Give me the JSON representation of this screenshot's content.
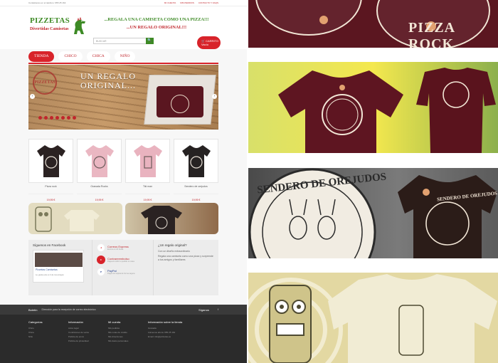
{
  "store": {
    "topbar": {
      "left": "Contáctanos en el teléfono: 955 25 164",
      "right_items": [
        "MI CUENTA",
        "MIS PEDIDOS",
        "CONTACTO Y FAQS"
      ]
    },
    "logo": {
      "line1": "PIZZETAS",
      "line2": "Divertidas Camisetas"
    },
    "slogan": {
      "line1": "...REGALA UNA CAMISETA COMO UNA PIZZA!!!",
      "line2": "...UN REGALO ORIGINAL!!!"
    },
    "cart": {
      "label": "CARRITO",
      "sub": "Vacío"
    },
    "search": {
      "placeholder": "BUSCAR",
      "button": "🔍"
    },
    "nav": [
      "TIENDA",
      "CHICO",
      "CHICA",
      "NIÑO"
    ],
    "slider": {
      "caption1": "UN REGALO",
      "caption2": "ORIGINAL...",
      "stamp": "PIZZETAS",
      "prev": "‹",
      "next": "›"
    },
    "products": [
      {
        "name": "Pizza rock",
        "price": "19,95 €"
      },
      {
        "name": "Granada Rocks",
        "price": "19,95 €"
      },
      {
        "name": "Tiki man",
        "price": "19,95 €"
      },
      {
        "name": "Sendero de orejudos",
        "price": "19,95 €"
      }
    ],
    "widgets": {
      "facebook": {
        "title": "Síguenos en Facebook",
        "caption": "Pizzetas Camisetas",
        "note": "Le gusta esto a 4 de tus amigos"
      },
      "payments": [
        {
          "name": "Correos Express",
          "sub": "Envíos en 24 horas",
          "icon": "truck-icon",
          "color": "#d8232a"
        },
        {
          "name": "Contrareembolso",
          "sub": "Paga al recibir tu pedido en casa",
          "icon": "cash-icon",
          "color": "#d8232a"
        },
        {
          "name": "PayPal",
          "sub": "Paga con tarjeta de forma segura",
          "icon": "paypal-icon",
          "color": "#1f3b8a"
        }
      ],
      "gift": {
        "title": "¿Un regalo original?",
        "sub": "Con un diseño extraordinario",
        "body": "Regala una camiseta como una pizza y sorprende a tus amigos y familiares"
      }
    },
    "footer": {
      "newsletter_label": "Boletín",
      "newsletter_text": "Dirección para la recepción de correo electrónico",
      "follow_label": "Síganos",
      "follow_icon": "facebook-icon",
      "columns": [
        {
          "title": "Categorías",
          "items": [
            "Chico",
            "Chica",
            "Niño"
          ]
        },
        {
          "title": "Información",
          "items": [
            "Aviso legal",
            "Condiciones de venta",
            "Política de envío",
            "Política de privacidad"
          ]
        },
        {
          "title": "Mi cuenta",
          "items": [
            "Mis pedidos",
            "Mis notas de crédito",
            "Mis direcciones",
            "Mis datos personales"
          ]
        },
        {
          "title": "Información sobre la tienda",
          "items": [
            "Granada",
            "Llámenos ahora: 955 25 164",
            "Email: info@pizzetas.es"
          ]
        }
      ]
    },
    "colors": {
      "accent": "#d8232a",
      "brand_green": "#3d8a25",
      "footer_dark": "#2b2b2b"
    }
  },
  "photos": {
    "p1_title": "PIZZA ROCK",
    "p3_title": "SENDERO DE OREJUDOS",
    "p3_shirt_title": "SENDERO DE OREJUDOS"
  }
}
